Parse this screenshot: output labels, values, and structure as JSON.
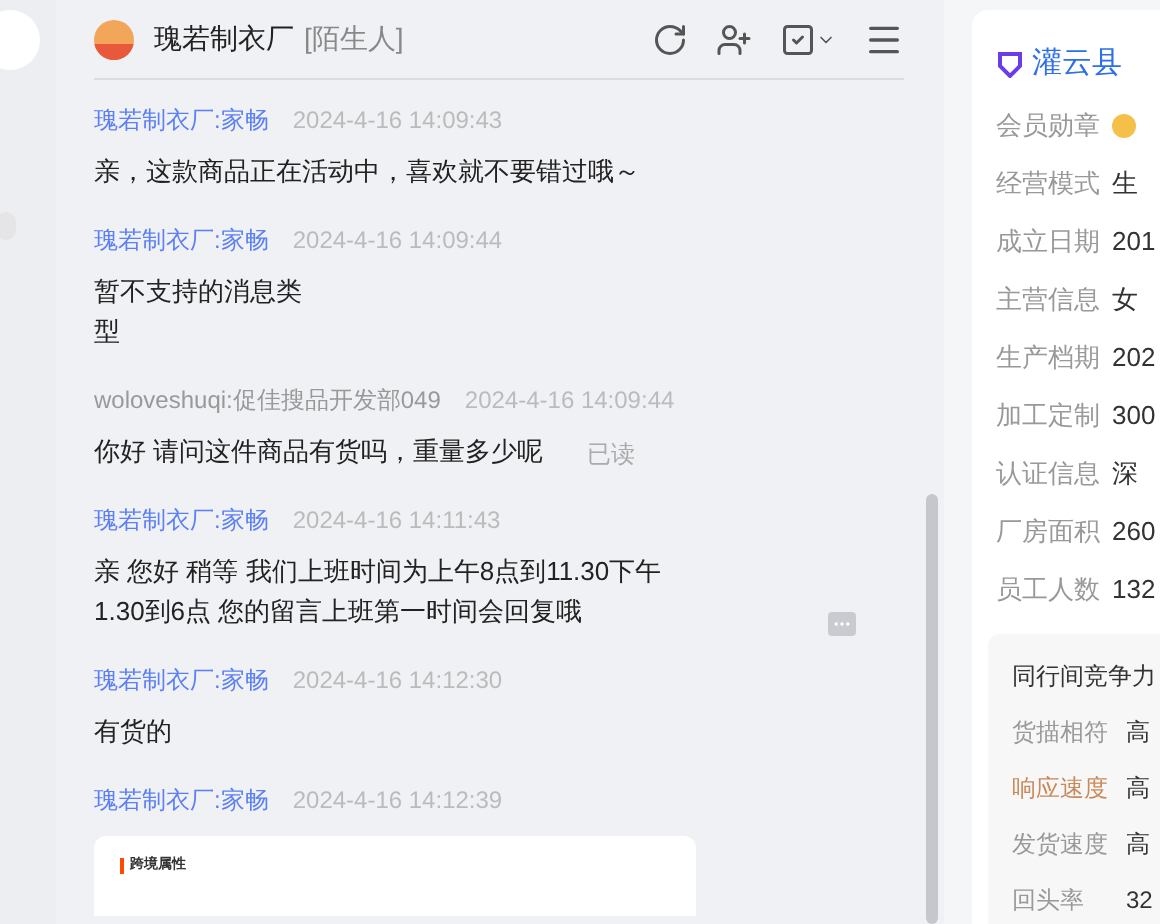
{
  "header": {
    "title": "瑰若制衣厂",
    "tag": "[陌生人]"
  },
  "messages": [
    {
      "sender": "瑰若制衣厂:家畅",
      "time": "2024-4-16 14:09:43",
      "kind": "text",
      "from_me": false,
      "lines": [
        "亲，这款商品正在活动中，喜欢就不要错过哦～"
      ]
    },
    {
      "sender": "瑰若制衣厂:家畅",
      "time": "2024-4-16 14:09:44",
      "kind": "text",
      "from_me": false,
      "lines": [
        "暂不支持的消息类",
        "型"
      ]
    },
    {
      "sender": "woloveshuqi:促佳搜品开发部049",
      "time": "2024-4-16 14:09:44",
      "kind": "text",
      "from_me": true,
      "lines": [
        "你好 请问这件商品有货吗，重量多少呢"
      ],
      "status": "已读"
    },
    {
      "sender": "瑰若制衣厂:家畅",
      "time": "2024-4-16 14:11:43",
      "kind": "text",
      "from_me": false,
      "lines": [
        "亲 您好 稍等 我们上班时间为上午8点到11.30下午",
        "1.30到6点 您的留言上班第一时间会回复哦"
      ],
      "more": true
    },
    {
      "sender": "瑰若制衣厂:家畅",
      "time": "2024-4-16 14:12:30",
      "kind": "text",
      "from_me": false,
      "lines": [
        "有货的"
      ]
    },
    {
      "sender": "瑰若制衣厂:家畅",
      "time": "2024-4-16 14:12:39",
      "kind": "card",
      "from_me": false,
      "card_title": "跨境属性"
    }
  ],
  "company": {
    "name": "灌云县",
    "info": [
      {
        "label": "会员勋章",
        "kind": "badge"
      },
      {
        "label": "经营模式",
        "value": "生"
      },
      {
        "label": "成立日期",
        "value": "201"
      },
      {
        "label": "主营信息",
        "value": "女"
      },
      {
        "label": "生产档期",
        "value": "202"
      },
      {
        "label": "加工定制",
        "value": "300"
      },
      {
        "label": "认证信息",
        "value": "深"
      },
      {
        "label": "厂房面积",
        "value": "260"
      },
      {
        "label": "员工人数",
        "value": "132"
      }
    ],
    "competition": {
      "title": "同行间竞争力",
      "rows": [
        {
          "label": "货描相符",
          "value": "高",
          "highlight": false
        },
        {
          "label": "响应速度",
          "value": "高",
          "highlight": true
        },
        {
          "label": "发货速度",
          "value": "高",
          "highlight": false
        },
        {
          "label": "回头率",
          "value": "32",
          "highlight": false
        }
      ]
    }
  }
}
